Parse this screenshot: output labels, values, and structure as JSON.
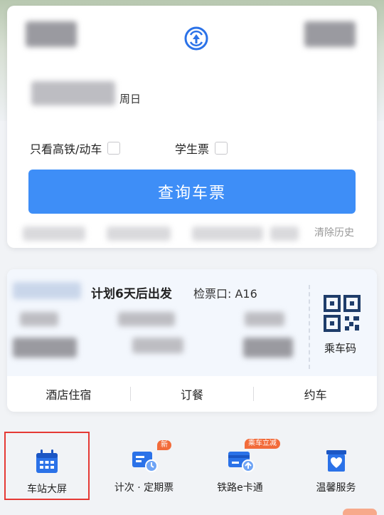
{
  "search": {
    "date_suffix": "周日",
    "filter_high_speed": "只看高铁/动车",
    "filter_student": "学生票",
    "query_button": "查询车票",
    "clear_history": "清除历史"
  },
  "trip": {
    "title": "计划6天后出发",
    "gate": "检票口: A16",
    "qr_label": "乘车码",
    "links": [
      "酒店住宿",
      "订餐",
      "约车"
    ]
  },
  "services": [
    {
      "label": "车站大屏",
      "icon": "calendar-icon",
      "badge": ""
    },
    {
      "label": "计次 · 定期票",
      "icon": "ticket-clock-icon",
      "badge": "新"
    },
    {
      "label": "铁路e卡通",
      "icon": "railway-card-icon",
      "badge": "乘车立减"
    },
    {
      "label": "温馨服务",
      "icon": "heart-bag-icon",
      "badge": ""
    }
  ],
  "colors": {
    "primary": "#3e8ef7",
    "icon_blue": "#2b72e8",
    "badge_orange": "#f26b3a",
    "highlight_red": "#e53935"
  }
}
